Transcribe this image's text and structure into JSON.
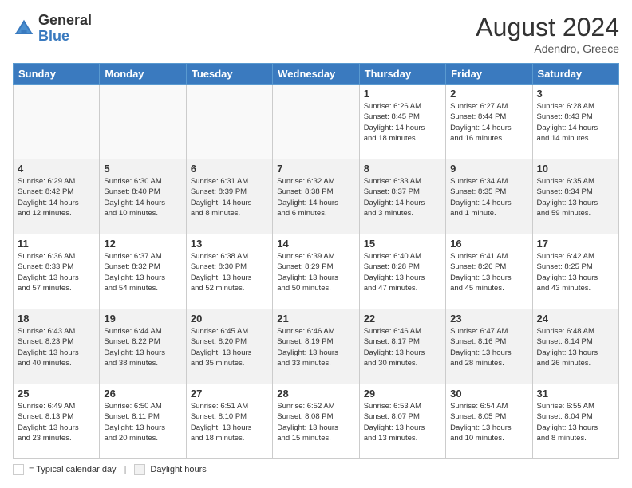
{
  "header": {
    "logo_general": "General",
    "logo_blue": "Blue",
    "month_year": "August 2024",
    "location": "Adendro, Greece"
  },
  "days_of_week": [
    "Sunday",
    "Monday",
    "Tuesday",
    "Wednesday",
    "Thursday",
    "Friday",
    "Saturday"
  ],
  "legend": {
    "daylight_label": "Daylight hours"
  },
  "weeks": [
    {
      "row_shade": false,
      "days": [
        {
          "num": "",
          "info": ""
        },
        {
          "num": "",
          "info": ""
        },
        {
          "num": "",
          "info": ""
        },
        {
          "num": "",
          "info": ""
        },
        {
          "num": "1",
          "info": "Sunrise: 6:26 AM\nSunset: 8:45 PM\nDaylight: 14 hours\nand 18 minutes."
        },
        {
          "num": "2",
          "info": "Sunrise: 6:27 AM\nSunset: 8:44 PM\nDaylight: 14 hours\nand 16 minutes."
        },
        {
          "num": "3",
          "info": "Sunrise: 6:28 AM\nSunset: 8:43 PM\nDaylight: 14 hours\nand 14 minutes."
        }
      ]
    },
    {
      "row_shade": true,
      "days": [
        {
          "num": "4",
          "info": "Sunrise: 6:29 AM\nSunset: 8:42 PM\nDaylight: 14 hours\nand 12 minutes."
        },
        {
          "num": "5",
          "info": "Sunrise: 6:30 AM\nSunset: 8:40 PM\nDaylight: 14 hours\nand 10 minutes."
        },
        {
          "num": "6",
          "info": "Sunrise: 6:31 AM\nSunset: 8:39 PM\nDaylight: 14 hours\nand 8 minutes."
        },
        {
          "num": "7",
          "info": "Sunrise: 6:32 AM\nSunset: 8:38 PM\nDaylight: 14 hours\nand 6 minutes."
        },
        {
          "num": "8",
          "info": "Sunrise: 6:33 AM\nSunset: 8:37 PM\nDaylight: 14 hours\nand 3 minutes."
        },
        {
          "num": "9",
          "info": "Sunrise: 6:34 AM\nSunset: 8:35 PM\nDaylight: 14 hours\nand 1 minute."
        },
        {
          "num": "10",
          "info": "Sunrise: 6:35 AM\nSunset: 8:34 PM\nDaylight: 13 hours\nand 59 minutes."
        }
      ]
    },
    {
      "row_shade": false,
      "days": [
        {
          "num": "11",
          "info": "Sunrise: 6:36 AM\nSunset: 8:33 PM\nDaylight: 13 hours\nand 57 minutes."
        },
        {
          "num": "12",
          "info": "Sunrise: 6:37 AM\nSunset: 8:32 PM\nDaylight: 13 hours\nand 54 minutes."
        },
        {
          "num": "13",
          "info": "Sunrise: 6:38 AM\nSunset: 8:30 PM\nDaylight: 13 hours\nand 52 minutes."
        },
        {
          "num": "14",
          "info": "Sunrise: 6:39 AM\nSunset: 8:29 PM\nDaylight: 13 hours\nand 50 minutes."
        },
        {
          "num": "15",
          "info": "Sunrise: 6:40 AM\nSunset: 8:28 PM\nDaylight: 13 hours\nand 47 minutes."
        },
        {
          "num": "16",
          "info": "Sunrise: 6:41 AM\nSunset: 8:26 PM\nDaylight: 13 hours\nand 45 minutes."
        },
        {
          "num": "17",
          "info": "Sunrise: 6:42 AM\nSunset: 8:25 PM\nDaylight: 13 hours\nand 43 minutes."
        }
      ]
    },
    {
      "row_shade": true,
      "days": [
        {
          "num": "18",
          "info": "Sunrise: 6:43 AM\nSunset: 8:23 PM\nDaylight: 13 hours\nand 40 minutes."
        },
        {
          "num": "19",
          "info": "Sunrise: 6:44 AM\nSunset: 8:22 PM\nDaylight: 13 hours\nand 38 minutes."
        },
        {
          "num": "20",
          "info": "Sunrise: 6:45 AM\nSunset: 8:20 PM\nDaylight: 13 hours\nand 35 minutes."
        },
        {
          "num": "21",
          "info": "Sunrise: 6:46 AM\nSunset: 8:19 PM\nDaylight: 13 hours\nand 33 minutes."
        },
        {
          "num": "22",
          "info": "Sunrise: 6:46 AM\nSunset: 8:17 PM\nDaylight: 13 hours\nand 30 minutes."
        },
        {
          "num": "23",
          "info": "Sunrise: 6:47 AM\nSunset: 8:16 PM\nDaylight: 13 hours\nand 28 minutes."
        },
        {
          "num": "24",
          "info": "Sunrise: 6:48 AM\nSunset: 8:14 PM\nDaylight: 13 hours\nand 26 minutes."
        }
      ]
    },
    {
      "row_shade": false,
      "days": [
        {
          "num": "25",
          "info": "Sunrise: 6:49 AM\nSunset: 8:13 PM\nDaylight: 13 hours\nand 23 minutes."
        },
        {
          "num": "26",
          "info": "Sunrise: 6:50 AM\nSunset: 8:11 PM\nDaylight: 13 hours\nand 20 minutes."
        },
        {
          "num": "27",
          "info": "Sunrise: 6:51 AM\nSunset: 8:10 PM\nDaylight: 13 hours\nand 18 minutes."
        },
        {
          "num": "28",
          "info": "Sunrise: 6:52 AM\nSunset: 8:08 PM\nDaylight: 13 hours\nand 15 minutes."
        },
        {
          "num": "29",
          "info": "Sunrise: 6:53 AM\nSunset: 8:07 PM\nDaylight: 13 hours\nand 13 minutes."
        },
        {
          "num": "30",
          "info": "Sunrise: 6:54 AM\nSunset: 8:05 PM\nDaylight: 13 hours\nand 10 minutes."
        },
        {
          "num": "31",
          "info": "Sunrise: 6:55 AM\nSunset: 8:04 PM\nDaylight: 13 hours\nand 8 minutes."
        }
      ]
    }
  ]
}
